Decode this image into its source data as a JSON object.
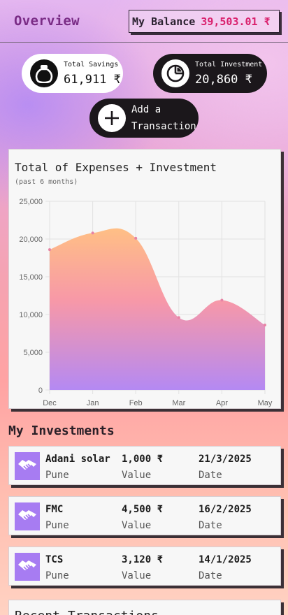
{
  "header": {
    "title": "Overview",
    "balance_label": "My Balance",
    "balance_value": "39,503.01 ₹"
  },
  "summary": {
    "savings": {
      "label": "Total Savings",
      "value": "61,911 ₹",
      "icon": "money-bag-icon"
    },
    "investment": {
      "label": "Total Investment",
      "value": "20,860 ₹",
      "icon": "pie-chart-icon"
    },
    "add_transaction": {
      "line1": "Add a",
      "line2": "Transaction",
      "icon": "plus-icon"
    }
  },
  "chart": {
    "title": "Total of Expenses + Investment",
    "subtitle": "(past 6 months)"
  },
  "chart_data": {
    "type": "area",
    "title": "Total of Expenses + Investment",
    "subtitle": "(past 6 months)",
    "categories": [
      "Dec",
      "Jan",
      "Feb",
      "Mar",
      "Apr",
      "May"
    ],
    "values": [
      18600,
      20800,
      20100,
      9600,
      11900,
      8600
    ],
    "ylim": [
      0,
      25000
    ],
    "yticks": [
      "0",
      "5,000",
      "10,000",
      "15,000",
      "20,000",
      "25,000"
    ],
    "grid": true,
    "legend": "none",
    "colors": {
      "top": "#ffbf85",
      "middle": "#f798a8",
      "bottom": "#b489f3",
      "points": "#e783a5"
    }
  },
  "investments": {
    "section_title": "My Investments",
    "value_label": "Value",
    "date_label": "Date",
    "items": [
      {
        "name": "Adani solar",
        "city": "Pune",
        "value": "1,000 ₹",
        "date": "21/3/2025",
        "icon": "handshake-icon"
      },
      {
        "name": "FMC",
        "city": "Pune",
        "value": "4,500 ₹",
        "date": "16/2/2025",
        "icon": "handshake-icon"
      },
      {
        "name": "TCS",
        "city": "Pune",
        "value": "3,120 ₹",
        "date": "14/1/2025",
        "icon": "handshake-icon"
      }
    ]
  },
  "recent": {
    "title": "Recent Transactions"
  }
}
